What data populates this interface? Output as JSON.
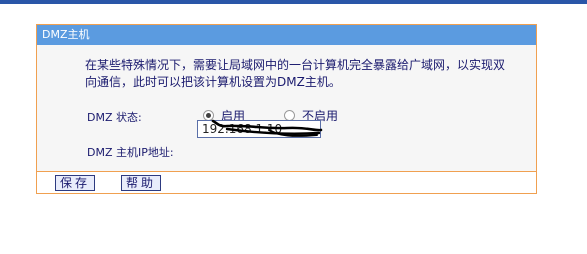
{
  "section": {
    "title": "DMZ主机",
    "description": "在某些特殊情况下，需要让局域网中的一台计算机完全暴露给广域网，以实现双向通信，此时可以把该计算机设置为DMZ主机。"
  },
  "dmz_status": {
    "label": "DMZ 状态:",
    "options": [
      {
        "label": "启用",
        "checked": true
      },
      {
        "label": "不启用",
        "checked": false
      }
    ]
  },
  "dmz_host_ip": {
    "label": "DMZ 主机IP地址:",
    "value": "192.168.1.10"
  },
  "buttons": {
    "save": "保存",
    "help": "帮助"
  },
  "colors": {
    "title_bar": "#5b9be0",
    "border": "#f0a050",
    "text": "#1a1a6e",
    "top_bar": "#2a56a8"
  }
}
